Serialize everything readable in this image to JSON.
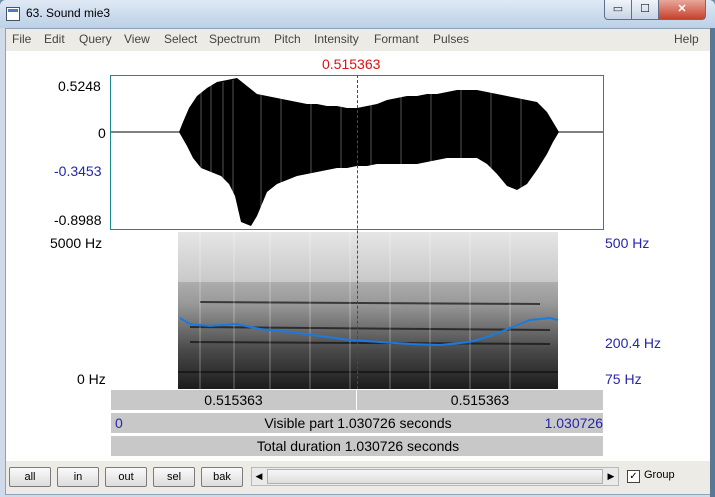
{
  "window": {
    "title": "63. Sound mie3",
    "minimize_glyph": "▭",
    "maximize_glyph": "☐",
    "close_glyph": "✕"
  },
  "menu": [
    "File",
    "Edit",
    "Query",
    "View",
    "Select",
    "Spectrum",
    "Pitch",
    "Intensity",
    "Formant",
    "Pulses",
    "Help"
  ],
  "cursor_time": "0.515363",
  "waveform": {
    "ymax": "0.5248",
    "yzero": "0",
    "ycursor": "-0.3453",
    "ymin": "-0.8988"
  },
  "spectrogram": {
    "fmax": "5000 Hz",
    "fmin": "0 Hz",
    "pitch_max": "500 Hz",
    "pitch_cursor": "200.4 Hz",
    "pitch_min": "75 Hz"
  },
  "bars": {
    "left_time": "0.515363",
    "right_time": "0.515363",
    "visible_start": "0",
    "visible_label": "Visible part 1.030726 seconds",
    "visible_end": "1.030726",
    "total_label": "Total duration 1.030726 seconds"
  },
  "buttons": {
    "all": "all",
    "in": "in",
    "out": "out",
    "sel": "sel",
    "bak": "bak"
  },
  "group": {
    "label": "Group",
    "checked": true,
    "check_glyph": "✓"
  },
  "scroll": {
    "left_arrow": "◀",
    "right_arrow": "▶"
  },
  "colors": {
    "cursor": "#d11111",
    "axis_blue": "#2525b0",
    "pitch": "#1a7ae0",
    "frame": "#1b8a8a"
  }
}
